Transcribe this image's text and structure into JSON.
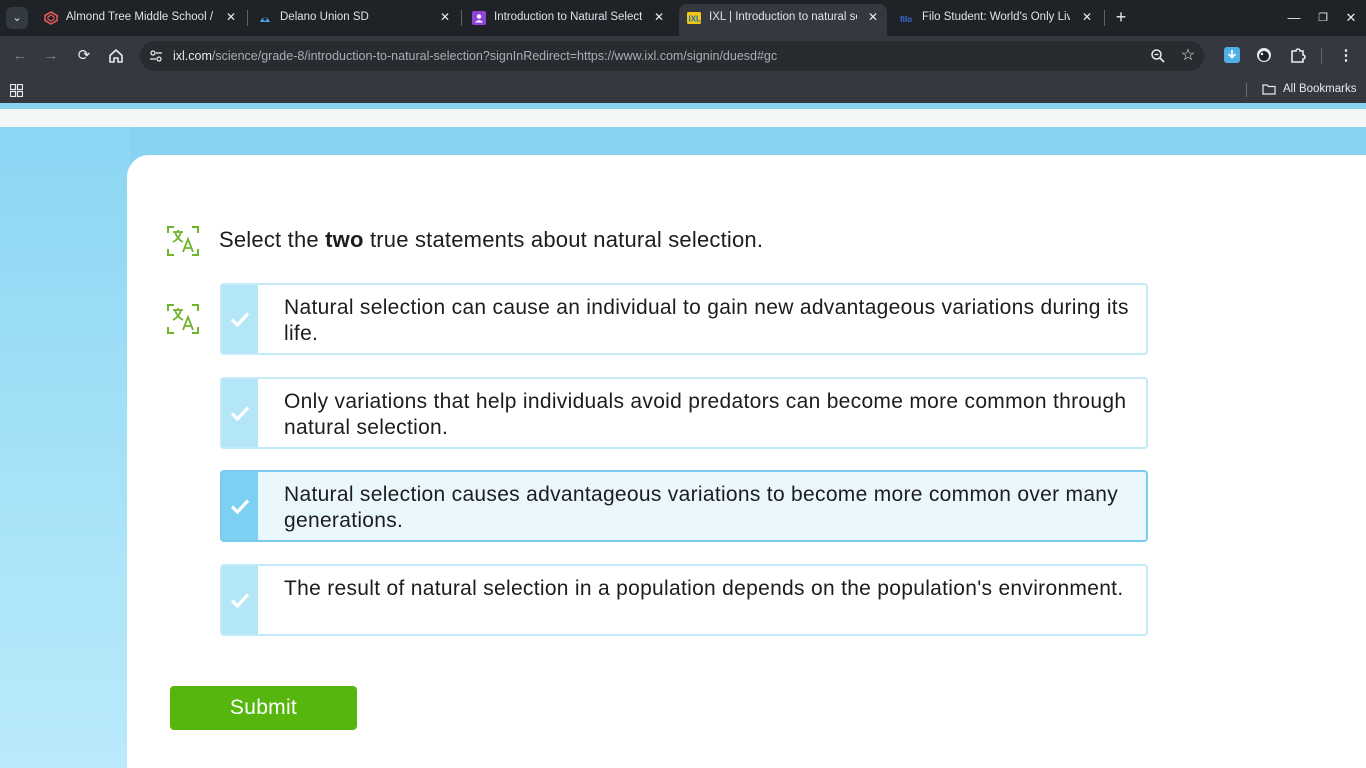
{
  "browser": {
    "tabs": [
      {
        "title": "Almond Tree Middle School / H",
        "icon": "school-icon"
      },
      {
        "title": "Delano Union SD",
        "icon": "district-icon"
      },
      {
        "title": "Introduction to Natural Selectio",
        "icon": "classroom-icon"
      },
      {
        "title": "IXL | Introduction to natural sel",
        "icon": "ixl-icon",
        "active": true
      },
      {
        "title": "Filo Student: World's Only Live I",
        "icon": "filo-icon"
      }
    ],
    "url_host": "ixl.com",
    "url_rest": "/science/grade-8/introduction-to-natural-selection?signInRedirect=https://www.ixl.com/signin/duesd#gc",
    "bookmarks_label": "All Bookmarks"
  },
  "question": {
    "prefix": "Select the",
    "emphasis": "two",
    "suffix": "true statements about natural selection."
  },
  "options": [
    {
      "text": "Natural selection can cause an individual to gain new advantageous variations during its life.",
      "selected": false
    },
    {
      "text": "Only variations that help individuals avoid predators can become more common through natural selection.",
      "selected": false
    },
    {
      "text": "Natural selection causes advantageous variations to become more common over many generations.",
      "selected": true
    },
    {
      "text": "The result of natural selection in a population depends on the population's environment.",
      "selected": false
    }
  ],
  "submit_label": "Submit",
  "colors": {
    "accent_green": "#57b60e",
    "page_blue": "#87d3f1",
    "check_blue": "#b3e7f8",
    "check_selected": "#7cd0f2"
  }
}
